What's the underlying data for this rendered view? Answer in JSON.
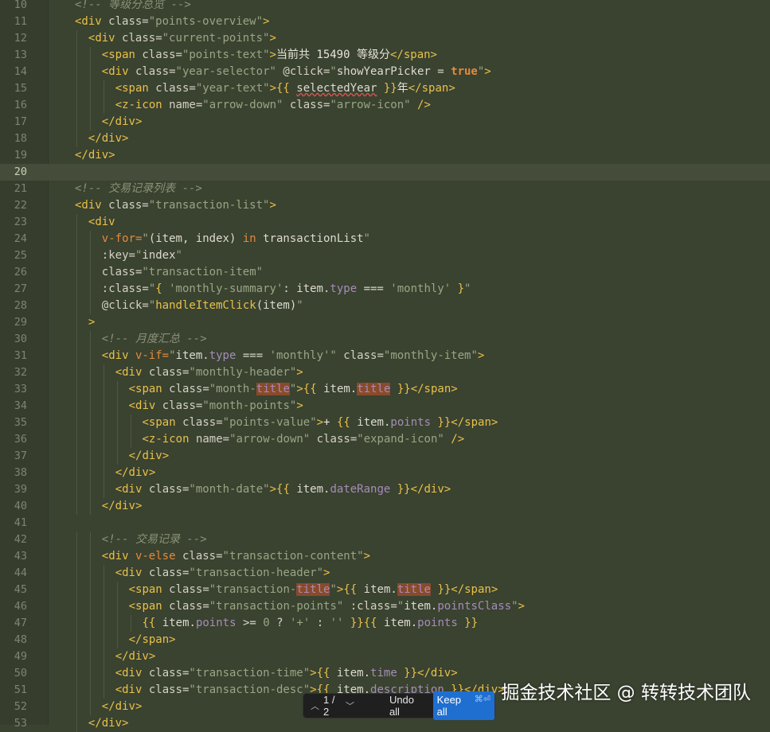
{
  "editor": {
    "active_line": 20,
    "lines": [
      {
        "n": "10",
        "indent": 2,
        "tokens": [
          [
            "cm",
            "<!-- 等级分总览 -->"
          ]
        ]
      },
      {
        "n": "11",
        "indent": 2,
        "tokens": [
          [
            "tag",
            "<div "
          ],
          [
            "attr",
            "class="
          ],
          [
            "str",
            "\"points-overview\""
          ],
          [
            "tag",
            ">"
          ]
        ]
      },
      {
        "n": "12",
        "indent": 3,
        "tokens": [
          [
            "tag",
            "<div "
          ],
          [
            "attr",
            "class="
          ],
          [
            "str",
            "\"current-points\""
          ],
          [
            "tag",
            ">"
          ]
        ]
      },
      {
        "n": "13",
        "indent": 4,
        "tokens": [
          [
            "tag",
            "<span "
          ],
          [
            "attr",
            "class="
          ],
          [
            "str",
            "\"points-text\""
          ],
          [
            "tag",
            ">"
          ],
          [
            "txt",
            "当前共 15490 等级分"
          ],
          [
            "tag",
            "</span>"
          ]
        ]
      },
      {
        "n": "14",
        "indent": 4,
        "tokens": [
          [
            "tag",
            "<div "
          ],
          [
            "attr",
            "class="
          ],
          [
            "str",
            "\"year-selector\""
          ],
          [
            "attr",
            " @click="
          ],
          [
            "str",
            "\""
          ],
          [
            "var",
            "showYearPicker "
          ],
          [
            "op",
            "= "
          ],
          [
            "bool",
            "true"
          ],
          [
            "str",
            "\""
          ],
          [
            "tag",
            ">"
          ]
        ]
      },
      {
        "n": "15",
        "indent": 5,
        "tokens": [
          [
            "tag",
            "<span "
          ],
          [
            "attr",
            "class="
          ],
          [
            "str",
            "\"year-text\""
          ],
          [
            "tag",
            ">"
          ],
          [
            "mus",
            "{{ "
          ],
          [
            "squig",
            "selectedYear"
          ],
          [
            "mus",
            " }}"
          ],
          [
            "txt",
            "年"
          ],
          [
            "tag",
            "</span>"
          ]
        ]
      },
      {
        "n": "16",
        "indent": 5,
        "tokens": [
          [
            "tag",
            "<z-icon "
          ],
          [
            "attr",
            "name="
          ],
          [
            "str",
            "\"arrow-down\""
          ],
          [
            "attr",
            " class="
          ],
          [
            "str",
            "\"arrow-icon\""
          ],
          [
            "tag",
            " />"
          ]
        ]
      },
      {
        "n": "17",
        "indent": 4,
        "tokens": [
          [
            "tag",
            "</div>"
          ]
        ]
      },
      {
        "n": "18",
        "indent": 3,
        "tokens": [
          [
            "tag",
            "</div>"
          ]
        ]
      },
      {
        "n": "19",
        "indent": 2,
        "tokens": [
          [
            "tag",
            "</div>"
          ]
        ]
      },
      {
        "n": "20",
        "indent": 0,
        "tokens": []
      },
      {
        "n": "21",
        "indent": 2,
        "tokens": [
          [
            "cm",
            "<!-- 交易记录列表 -->"
          ]
        ]
      },
      {
        "n": "22",
        "indent": 2,
        "tokens": [
          [
            "tag",
            "<div "
          ],
          [
            "attr",
            "class="
          ],
          [
            "str",
            "\"transaction-list\""
          ],
          [
            "tag",
            ">"
          ]
        ]
      },
      {
        "n": "23",
        "indent": 3,
        "tokens": [
          [
            "tag",
            "<div"
          ]
        ]
      },
      {
        "n": "24",
        "indent": 4,
        "tokens": [
          [
            "dir",
            "v-for="
          ],
          [
            "str",
            "\""
          ],
          [
            "var",
            "(item, index) "
          ],
          [
            "kw",
            "in"
          ],
          [
            "var",
            " transactionList"
          ],
          [
            "str",
            "\""
          ]
        ]
      },
      {
        "n": "25",
        "indent": 4,
        "tokens": [
          [
            "attr",
            ":key="
          ],
          [
            "str",
            "\""
          ],
          [
            "var",
            "index"
          ],
          [
            "str",
            "\""
          ]
        ]
      },
      {
        "n": "26",
        "indent": 4,
        "tokens": [
          [
            "attr",
            "class="
          ],
          [
            "str",
            "\"transaction-item\""
          ]
        ]
      },
      {
        "n": "27",
        "indent": 4,
        "tokens": [
          [
            "attr",
            ":class="
          ],
          [
            "str",
            "\""
          ],
          [
            "mus",
            "{ "
          ],
          [
            "str",
            "'monthly-summary'"
          ],
          [
            "var",
            ": item."
          ],
          [
            "prop",
            "type"
          ],
          [
            "op",
            " === "
          ],
          [
            "str",
            "'monthly'"
          ],
          [
            "mus",
            " }"
          ],
          [
            "str",
            "\""
          ]
        ]
      },
      {
        "n": "28",
        "indent": 4,
        "tokens": [
          [
            "attr",
            "@click="
          ],
          [
            "str",
            "\""
          ],
          [
            "fn",
            "handleItemClick"
          ],
          [
            "var",
            "(item)"
          ],
          [
            "str",
            "\""
          ]
        ]
      },
      {
        "n": "29",
        "indent": 3,
        "tokens": [
          [
            "tag",
            ">"
          ]
        ]
      },
      {
        "n": "30",
        "indent": 4,
        "tokens": [
          [
            "cm",
            "<!-- 月度汇总 -->"
          ]
        ]
      },
      {
        "n": "31",
        "indent": 4,
        "tokens": [
          [
            "tag",
            "<div "
          ],
          [
            "dir",
            "v-if="
          ],
          [
            "str",
            "\""
          ],
          [
            "var",
            "item."
          ],
          [
            "prop",
            "type"
          ],
          [
            "op",
            " === "
          ],
          [
            "str",
            "'monthly'\""
          ],
          [
            "attr",
            " class="
          ],
          [
            "str",
            "\"monthly-item\""
          ],
          [
            "tag",
            ">"
          ]
        ]
      },
      {
        "n": "32",
        "indent": 5,
        "tokens": [
          [
            "tag",
            "<div "
          ],
          [
            "attr",
            "class="
          ],
          [
            "str",
            "\"monthly-header\""
          ],
          [
            "tag",
            ">"
          ]
        ]
      },
      {
        "n": "33",
        "indent": 6,
        "tokens": [
          [
            "tag",
            "<span "
          ],
          [
            "attr",
            "class="
          ],
          [
            "str",
            "\"month-"
          ],
          [
            "hlstr",
            "title"
          ],
          [
            "str",
            "\""
          ],
          [
            "tag",
            ">"
          ],
          [
            "mus",
            "{{ "
          ],
          [
            "var",
            "item."
          ],
          [
            "hl",
            "title"
          ],
          [
            "mus",
            " }}"
          ],
          [
            "tag",
            "</span>"
          ]
        ]
      },
      {
        "n": "34",
        "indent": 6,
        "tokens": [
          [
            "tag",
            "<div "
          ],
          [
            "attr",
            "class="
          ],
          [
            "str",
            "\"month-points\""
          ],
          [
            "tag",
            ">"
          ]
        ]
      },
      {
        "n": "35",
        "indent": 7,
        "tokens": [
          [
            "tag",
            "<span "
          ],
          [
            "attr",
            "class="
          ],
          [
            "str",
            "\"points-value\""
          ],
          [
            "tag",
            ">"
          ],
          [
            "txt",
            "+ "
          ],
          [
            "mus",
            "{{ "
          ],
          [
            "var",
            "item."
          ],
          [
            "prop",
            "points"
          ],
          [
            "mus",
            " }}"
          ],
          [
            "tag",
            "</span>"
          ]
        ]
      },
      {
        "n": "36",
        "indent": 7,
        "tokens": [
          [
            "tag",
            "<z-icon "
          ],
          [
            "attr",
            "name="
          ],
          [
            "str",
            "\"arrow-down\""
          ],
          [
            "attr",
            " class="
          ],
          [
            "str",
            "\"expand-icon\""
          ],
          [
            "tag",
            " />"
          ]
        ]
      },
      {
        "n": "37",
        "indent": 6,
        "tokens": [
          [
            "tag",
            "</div>"
          ]
        ]
      },
      {
        "n": "38",
        "indent": 5,
        "tokens": [
          [
            "tag",
            "</div>"
          ]
        ]
      },
      {
        "n": "39",
        "indent": 5,
        "tokens": [
          [
            "tag",
            "<div "
          ],
          [
            "attr",
            "class="
          ],
          [
            "str",
            "\"month-date\""
          ],
          [
            "tag",
            ">"
          ],
          [
            "mus",
            "{{ "
          ],
          [
            "var",
            "item."
          ],
          [
            "prop",
            "dateRange"
          ],
          [
            "mus",
            " }}"
          ],
          [
            "tag",
            "</div>"
          ]
        ]
      },
      {
        "n": "40",
        "indent": 4,
        "tokens": [
          [
            "tag",
            "</div>"
          ]
        ]
      },
      {
        "n": "41",
        "indent": 0,
        "tokens": []
      },
      {
        "n": "42",
        "indent": 4,
        "tokens": [
          [
            "cm",
            "<!-- 交易记录 -->"
          ]
        ]
      },
      {
        "n": "43",
        "indent": 4,
        "tokens": [
          [
            "tag",
            "<div "
          ],
          [
            "dir",
            "v-else"
          ],
          [
            "attr",
            " class="
          ],
          [
            "str",
            "\"transaction-content\""
          ],
          [
            "tag",
            ">"
          ]
        ]
      },
      {
        "n": "44",
        "indent": 5,
        "tokens": [
          [
            "tag",
            "<div "
          ],
          [
            "attr",
            "class="
          ],
          [
            "str",
            "\"transaction-header\""
          ],
          [
            "tag",
            ">"
          ]
        ]
      },
      {
        "n": "45",
        "indent": 6,
        "tokens": [
          [
            "tag",
            "<span "
          ],
          [
            "attr",
            "class="
          ],
          [
            "str",
            "\"transaction-"
          ],
          [
            "hlstr",
            "title"
          ],
          [
            "str",
            "\""
          ],
          [
            "tag",
            ">"
          ],
          [
            "mus",
            "{{ "
          ],
          [
            "var",
            "item."
          ],
          [
            "hl",
            "title"
          ],
          [
            "mus",
            " }}"
          ],
          [
            "tag",
            "</span>"
          ]
        ]
      },
      {
        "n": "46",
        "indent": 6,
        "tokens": [
          [
            "tag",
            "<span "
          ],
          [
            "attr",
            "class="
          ],
          [
            "str",
            "\"transaction-points\""
          ],
          [
            "attr",
            " :class="
          ],
          [
            "str",
            "\""
          ],
          [
            "var",
            "item."
          ],
          [
            "prop",
            "pointsClass"
          ],
          [
            "str",
            "\""
          ],
          [
            "tag",
            ">"
          ]
        ]
      },
      {
        "n": "47",
        "indent": 7,
        "tokens": [
          [
            "mus",
            "{{ "
          ],
          [
            "var",
            "item."
          ],
          [
            "prop",
            "points"
          ],
          [
            "op",
            " >= "
          ],
          [
            "str",
            "0"
          ],
          [
            "op",
            " ? "
          ],
          [
            "str",
            "'+'"
          ],
          [
            "op",
            " : "
          ],
          [
            "str",
            "''"
          ],
          [
            "mus",
            " }}{{ "
          ],
          [
            "var",
            "item."
          ],
          [
            "prop",
            "points"
          ],
          [
            "mus",
            " }}"
          ]
        ]
      },
      {
        "n": "48",
        "indent": 6,
        "tokens": [
          [
            "tag",
            "</span>"
          ]
        ]
      },
      {
        "n": "49",
        "indent": 5,
        "tokens": [
          [
            "tag",
            "</div>"
          ]
        ]
      },
      {
        "n": "50",
        "indent": 5,
        "tokens": [
          [
            "tag",
            "<div "
          ],
          [
            "attr",
            "class="
          ],
          [
            "str",
            "\"transaction-time\""
          ],
          [
            "tag",
            ">"
          ],
          [
            "mus",
            "{{ "
          ],
          [
            "var",
            "item."
          ],
          [
            "prop",
            "time"
          ],
          [
            "mus",
            " }}"
          ],
          [
            "tag",
            "</div>"
          ]
        ]
      },
      {
        "n": "51",
        "indent": 5,
        "tokens": [
          [
            "tag",
            "<div "
          ],
          [
            "attr",
            "class="
          ],
          [
            "str",
            "\"transaction-desc\""
          ],
          [
            "tag",
            ">"
          ],
          [
            "mus",
            "{{ "
          ],
          [
            "var",
            "item."
          ],
          [
            "prop",
            "description"
          ],
          [
            "mus",
            " }}"
          ],
          [
            "tag",
            "</div>"
          ]
        ]
      },
      {
        "n": "52",
        "indent": 4,
        "tokens": [
          [
            "tag",
            "</div>"
          ]
        ]
      },
      {
        "n": "53",
        "indent": 3,
        "tokens": [
          [
            "tag",
            "</div>"
          ]
        ]
      }
    ]
  },
  "diff_bar": {
    "counter": "1 / 2",
    "undo_label": "Undo all",
    "keep_label": "Keep all",
    "keep_shortcut": "⌘⏎"
  },
  "watermark": "掘金技术社区 @ 转转技术团队"
}
